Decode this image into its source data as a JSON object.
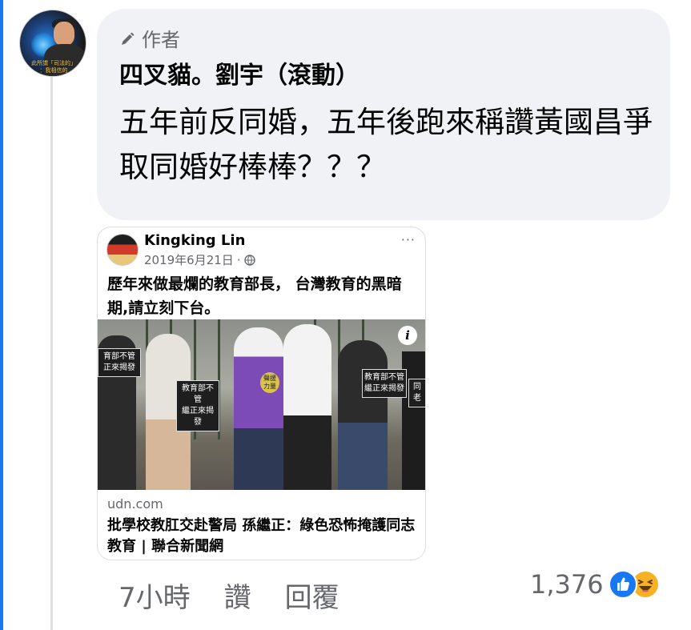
{
  "comment": {
    "author_badge": "作者",
    "author_name": "四叉貓。劉宇（滾動）",
    "text": "五年前反同婚，五年後跑來稱讚黃國昌爭取同婚好棒棒？？？",
    "avatar_caption_line1": "此所謂「司法的」",
    "avatar_caption_line2": "：我相信的"
  },
  "shared_post": {
    "author": "Kingking Lin",
    "date": "2019年6月21日",
    "more": "···",
    "text": "歷年來做最爛的教育部長， 台灣教育的黑暗期,請立刻下台。",
    "photo_signs": [
      "育部不管\n正來揭發",
      "教育部不管\n繼正來揭發",
      "教育部不管\n繼正來揭發",
      "同\n老"
    ],
    "photo_vest_text": "聲援\n力量",
    "link_domain": "udn.com",
    "link_title": "批學校教肛交赴警局 孫繼正：綠色恐怖掩護同志教育 | 聯合新聞網"
  },
  "actions": {
    "time": "7小時",
    "like": "讚",
    "reply": "回覆"
  },
  "reactions": {
    "count": "1,376",
    "types": [
      "like",
      "haha"
    ]
  },
  "colors": {
    "accent": "#1877f2",
    "bubble": "#f0f2f5",
    "secondary_text": "#65676b"
  }
}
